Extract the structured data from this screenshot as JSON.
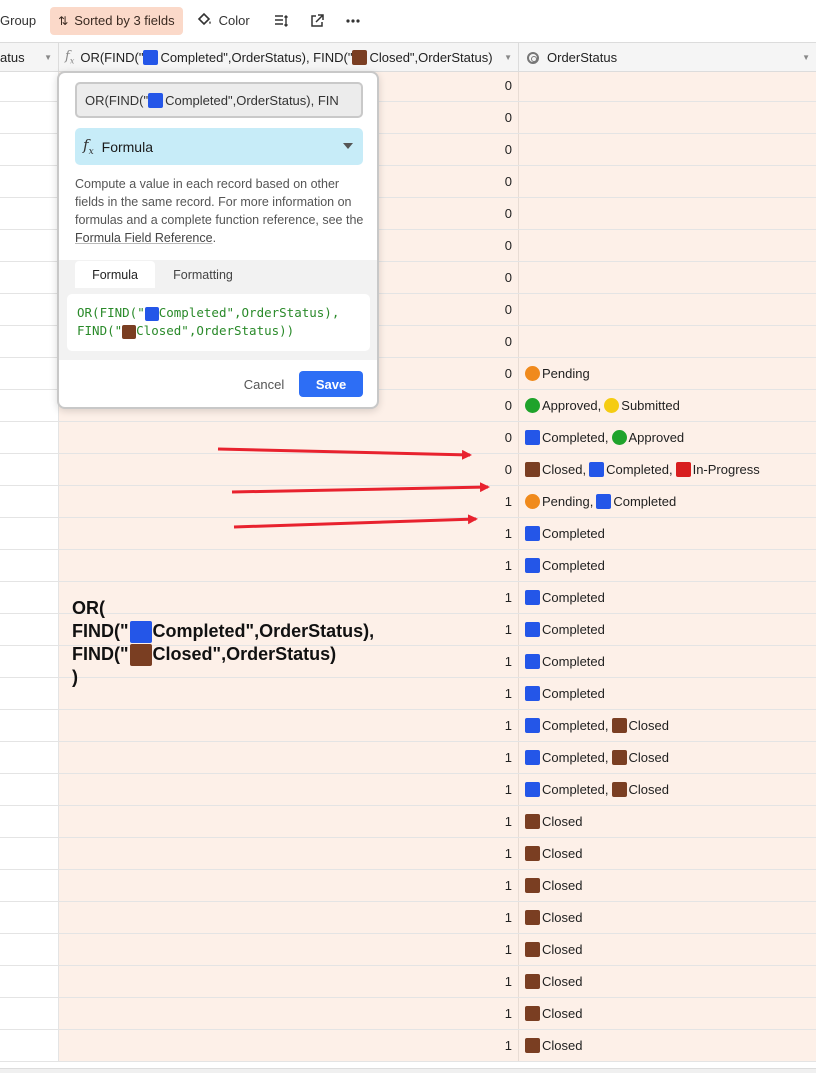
{
  "toolbar": {
    "group_label": "Group",
    "sorted_label": "Sorted by 3 fields",
    "color_label": "Color",
    "icons": [
      "row-height-icon",
      "share-icon",
      "more-icon"
    ]
  },
  "header": {
    "col1": "atus",
    "col2_prefix": "OR(FIND(\"",
    "col2_mid": "Completed\",OrderStatus), FIND(\"",
    "col2_suffix": "Closed\",OrderStatus)",
    "col3": "OrderStatus"
  },
  "status_colors": {
    "Completed": "#2456e8",
    "Closed": "#7a3e22",
    "Pending": "#f08a1c",
    "Approved": "#1fa32b",
    "Submitted": "#f5cc12",
    "In-Progress": "#d81e1e"
  },
  "rows": [
    {
      "value": "0",
      "statuses": []
    },
    {
      "value": "0",
      "statuses": []
    },
    {
      "value": "0",
      "statuses": []
    },
    {
      "value": "0",
      "statuses": []
    },
    {
      "value": "0",
      "statuses": []
    },
    {
      "value": "0",
      "statuses": []
    },
    {
      "value": "0",
      "statuses": []
    },
    {
      "value": "0",
      "statuses": []
    },
    {
      "value": "0",
      "statuses": []
    },
    {
      "value": "0",
      "statuses": [
        "Pending"
      ]
    },
    {
      "value": "0",
      "statuses": [
        "Approved",
        "Submitted"
      ]
    },
    {
      "value": "0",
      "statuses": [
        "Completed",
        "Approved"
      ]
    },
    {
      "value": "0",
      "statuses": [
        "Closed",
        "Completed",
        "In-Progress"
      ]
    },
    {
      "value": "1",
      "statuses": [
        "Pending",
        "Completed"
      ]
    },
    {
      "value": "1",
      "statuses": [
        "Completed"
      ]
    },
    {
      "value": "1",
      "statuses": [
        "Completed"
      ]
    },
    {
      "value": "1",
      "statuses": [
        "Completed"
      ]
    },
    {
      "value": "1",
      "statuses": [
        "Completed"
      ]
    },
    {
      "value": "1",
      "statuses": [
        "Completed"
      ]
    },
    {
      "value": "1",
      "statuses": [
        "Completed"
      ]
    },
    {
      "value": "1",
      "statuses": [
        "Completed",
        "Closed"
      ]
    },
    {
      "value": "1",
      "statuses": [
        "Completed",
        "Closed"
      ]
    },
    {
      "value": "1",
      "statuses": [
        "Completed",
        "Closed"
      ]
    },
    {
      "value": "1",
      "statuses": [
        "Closed"
      ]
    },
    {
      "value": "1",
      "statuses": [
        "Closed"
      ]
    },
    {
      "value": "1",
      "statuses": [
        "Closed"
      ]
    },
    {
      "value": "1",
      "statuses": [
        "Closed"
      ]
    },
    {
      "value": "1",
      "statuses": [
        "Closed"
      ]
    },
    {
      "value": "1",
      "statuses": [
        "Closed"
      ]
    },
    {
      "value": "1",
      "statuses": [
        "Closed"
      ]
    },
    {
      "value": "1",
      "statuses": [
        "Closed"
      ]
    }
  ],
  "annotation": {
    "line1": "OR(",
    "line2_a": "FIND(\"",
    "line2_b": "Completed\",OrderStatus),",
    "line3_a": "FIND(\"",
    "line3_b": "Closed\",OrderStatus)",
    "line4": ")"
  },
  "popup": {
    "name_a": "OR(FIND(\"",
    "name_b": "Completed\",OrderStatus), FIN",
    "field_type": "Formula",
    "desc_text": "Compute a value in each record based on other fields in the same record. For more information on formulas and a complete function reference, see the ",
    "desc_link": "Formula Field Reference",
    "desc_end": ".",
    "tab_formula": "Formula",
    "tab_formatting": "Formatting",
    "code_line1_a": "OR(FIND(\"",
    "code_line1_b": "Completed\",OrderStatus),",
    "code_line2_a": "FIND(\"",
    "code_line2_b": "Closed\",OrderStatus))",
    "cancel_label": "Cancel",
    "save_label": "Save"
  }
}
